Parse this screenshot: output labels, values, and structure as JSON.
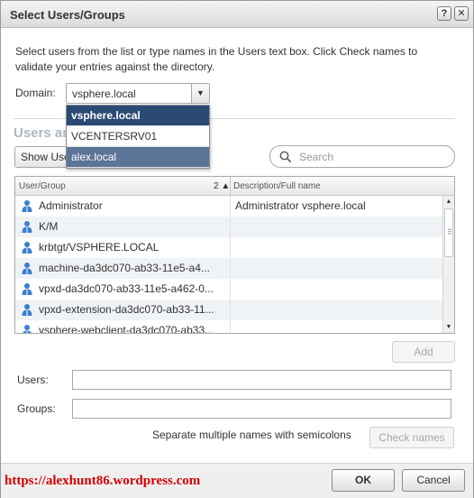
{
  "window": {
    "title": "Select Users/Groups",
    "help_label": "?",
    "close_label": "✕"
  },
  "instructions": "Select users from the list or type names in the Users text box. Click Check names to validate your entries against the directory.",
  "domain": {
    "label": "Domain:",
    "selected": "vsphere.local",
    "options": [
      "vsphere.local",
      "VCENTERSRV01",
      "alex.local"
    ]
  },
  "section_title": "Users and Groups",
  "show_button_label": "Show Users First",
  "search": {
    "placeholder": "Search"
  },
  "table": {
    "columns": [
      "User/Group",
      "Description/Full name"
    ],
    "sort_indicator": "2 ▲",
    "rows": [
      {
        "name": "Administrator",
        "description": "Administrator vsphere.local"
      },
      {
        "name": "K/M",
        "description": ""
      },
      {
        "name": "krbtgt/VSPHERE.LOCAL",
        "description": ""
      },
      {
        "name": "machine-da3dc070-ab33-11e5-a4...",
        "description": ""
      },
      {
        "name": "vpxd-da3dc070-ab33-11e5-a462-0...",
        "description": ""
      },
      {
        "name": "vpxd-extension-da3dc070-ab33-11...",
        "description": ""
      },
      {
        "name": "vsphere-webclient-da3dc070-ab33...",
        "description": ""
      }
    ]
  },
  "add_button_label": "Add",
  "users_label": "Users:",
  "groups_label": "Groups:",
  "users_value": "",
  "groups_value": "",
  "hint": "Separate multiple names with semicolons",
  "check_names_label": "Check names",
  "ok_label": "OK",
  "cancel_label": "Cancel",
  "watermark": "https://alexhunt86.wordpress.com",
  "colors": {
    "dropdown_selected": "#2a4a73",
    "dropdown_hover": "#5b7497",
    "watermark": "#d40000",
    "user_icon": "#3a7fd0"
  }
}
